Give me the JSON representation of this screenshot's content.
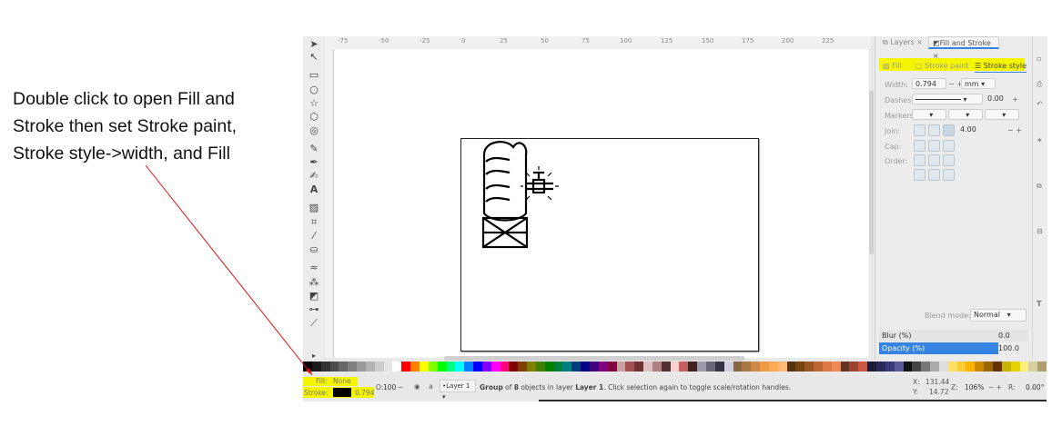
{
  "instruction": {
    "lines": [
      "Double click to open Fill and",
      "Stroke then set Stroke paint,",
      "Stroke style->width, and Fill"
    ]
  },
  "ruler": {
    "top_ticks": [
      "-75",
      "-50",
      "-25",
      "0",
      "25",
      "50",
      "75",
      "100",
      "125",
      "150",
      "175",
      "200",
      "225"
    ]
  },
  "panel": {
    "tabs": [
      "Layers",
      "Fill and Stroke"
    ],
    "subtabs": [
      "Fill",
      "Stroke paint",
      "Stroke style"
    ],
    "width_label": "Width:",
    "width_value": "0.794",
    "width_unit": "mm",
    "dashes_label": "Dashes:",
    "dashes_value": "0.00",
    "markers_label": "Markers:",
    "join_label": "Join:",
    "join_value": "4.00",
    "cap_label": "Cap:",
    "order_label": "Order:",
    "blend_label": "Blend mode:",
    "blend_value": "Normal",
    "blur_label": "Blur (%)",
    "blur_value": "0.0",
    "opacity_label": "Opacity (%)",
    "opacity_value": "100.0"
  },
  "status": {
    "fill_label": "Fill:",
    "fill_value": "None",
    "stroke_label": "Stroke:",
    "stroke_width": "0.794",
    "o_label": "O:",
    "o_value": "100",
    "layer": "Layer 1",
    "message_prefix": "Group",
    "message_mid": "of",
    "message_count": "8",
    "message_rest": "objects in layer",
    "message_layer": "Layer 1",
    "message_tail": ". Click selection again to toggle scale/rotation handles.",
    "x_label": "X:",
    "x_value": "131.44",
    "y_label": "Y:",
    "y_value": "14.72",
    "z_label": "Z:",
    "zoom": "106%",
    "r_label": "R:",
    "rotation": "0.00°"
  },
  "colors": {
    "highlight": "#f6f500",
    "accent": "#3584e4",
    "arrow": "#e01010"
  },
  "palette_colors": [
    "#000",
    "#1a1a1a",
    "#333",
    "#4d4d4d",
    "#666",
    "#808080",
    "#999",
    "#b3b3b3",
    "#ccc",
    "#e6e6e6",
    "#fff",
    "#f00",
    "#ff8000",
    "#ff0",
    "#80ff00",
    "#0f0",
    "#00ff80",
    "#0ff",
    "#0080ff",
    "#00f",
    "#8000ff",
    "#f0f",
    "#ff0080",
    "#800000",
    "#804000",
    "#808000",
    "#408000",
    "#008000",
    "#008040",
    "#008080",
    "#004080",
    "#000080",
    "#400080",
    "#800080",
    "#800040",
    "#c8a0a0",
    "#a05050",
    "#703030",
    "#e0c0c0",
    "#b08080",
    "#503030",
    "#ffd0d0",
    "#c06060",
    "#402020",
    "#9a9aaa",
    "#666677",
    "#333344",
    "#d0d0e0",
    "#886644",
    "#aa7744",
    "#cc8844",
    "#ee9944",
    "#ffaa55",
    "#ffbb77",
    "#553311",
    "#774411",
    "#995522",
    "#bb6633",
    "#dd7744",
    "#ee8855",
    "#663322",
    "#994433",
    "#cc5544",
    "#1a1a3a",
    "#2a2a5a",
    "#3a3a7a",
    "#5a5a9a",
    "#111",
    "#444",
    "#777",
    "#aaa",
    "#ddd",
    "#ffe066",
    "#ffcc33",
    "#ffb300",
    "#cc8800",
    "#996600",
    "#663300",
    "#c8b400",
    "#e6d200",
    "#fff080",
    "#d8d0a0",
    "#b0a070"
  ]
}
